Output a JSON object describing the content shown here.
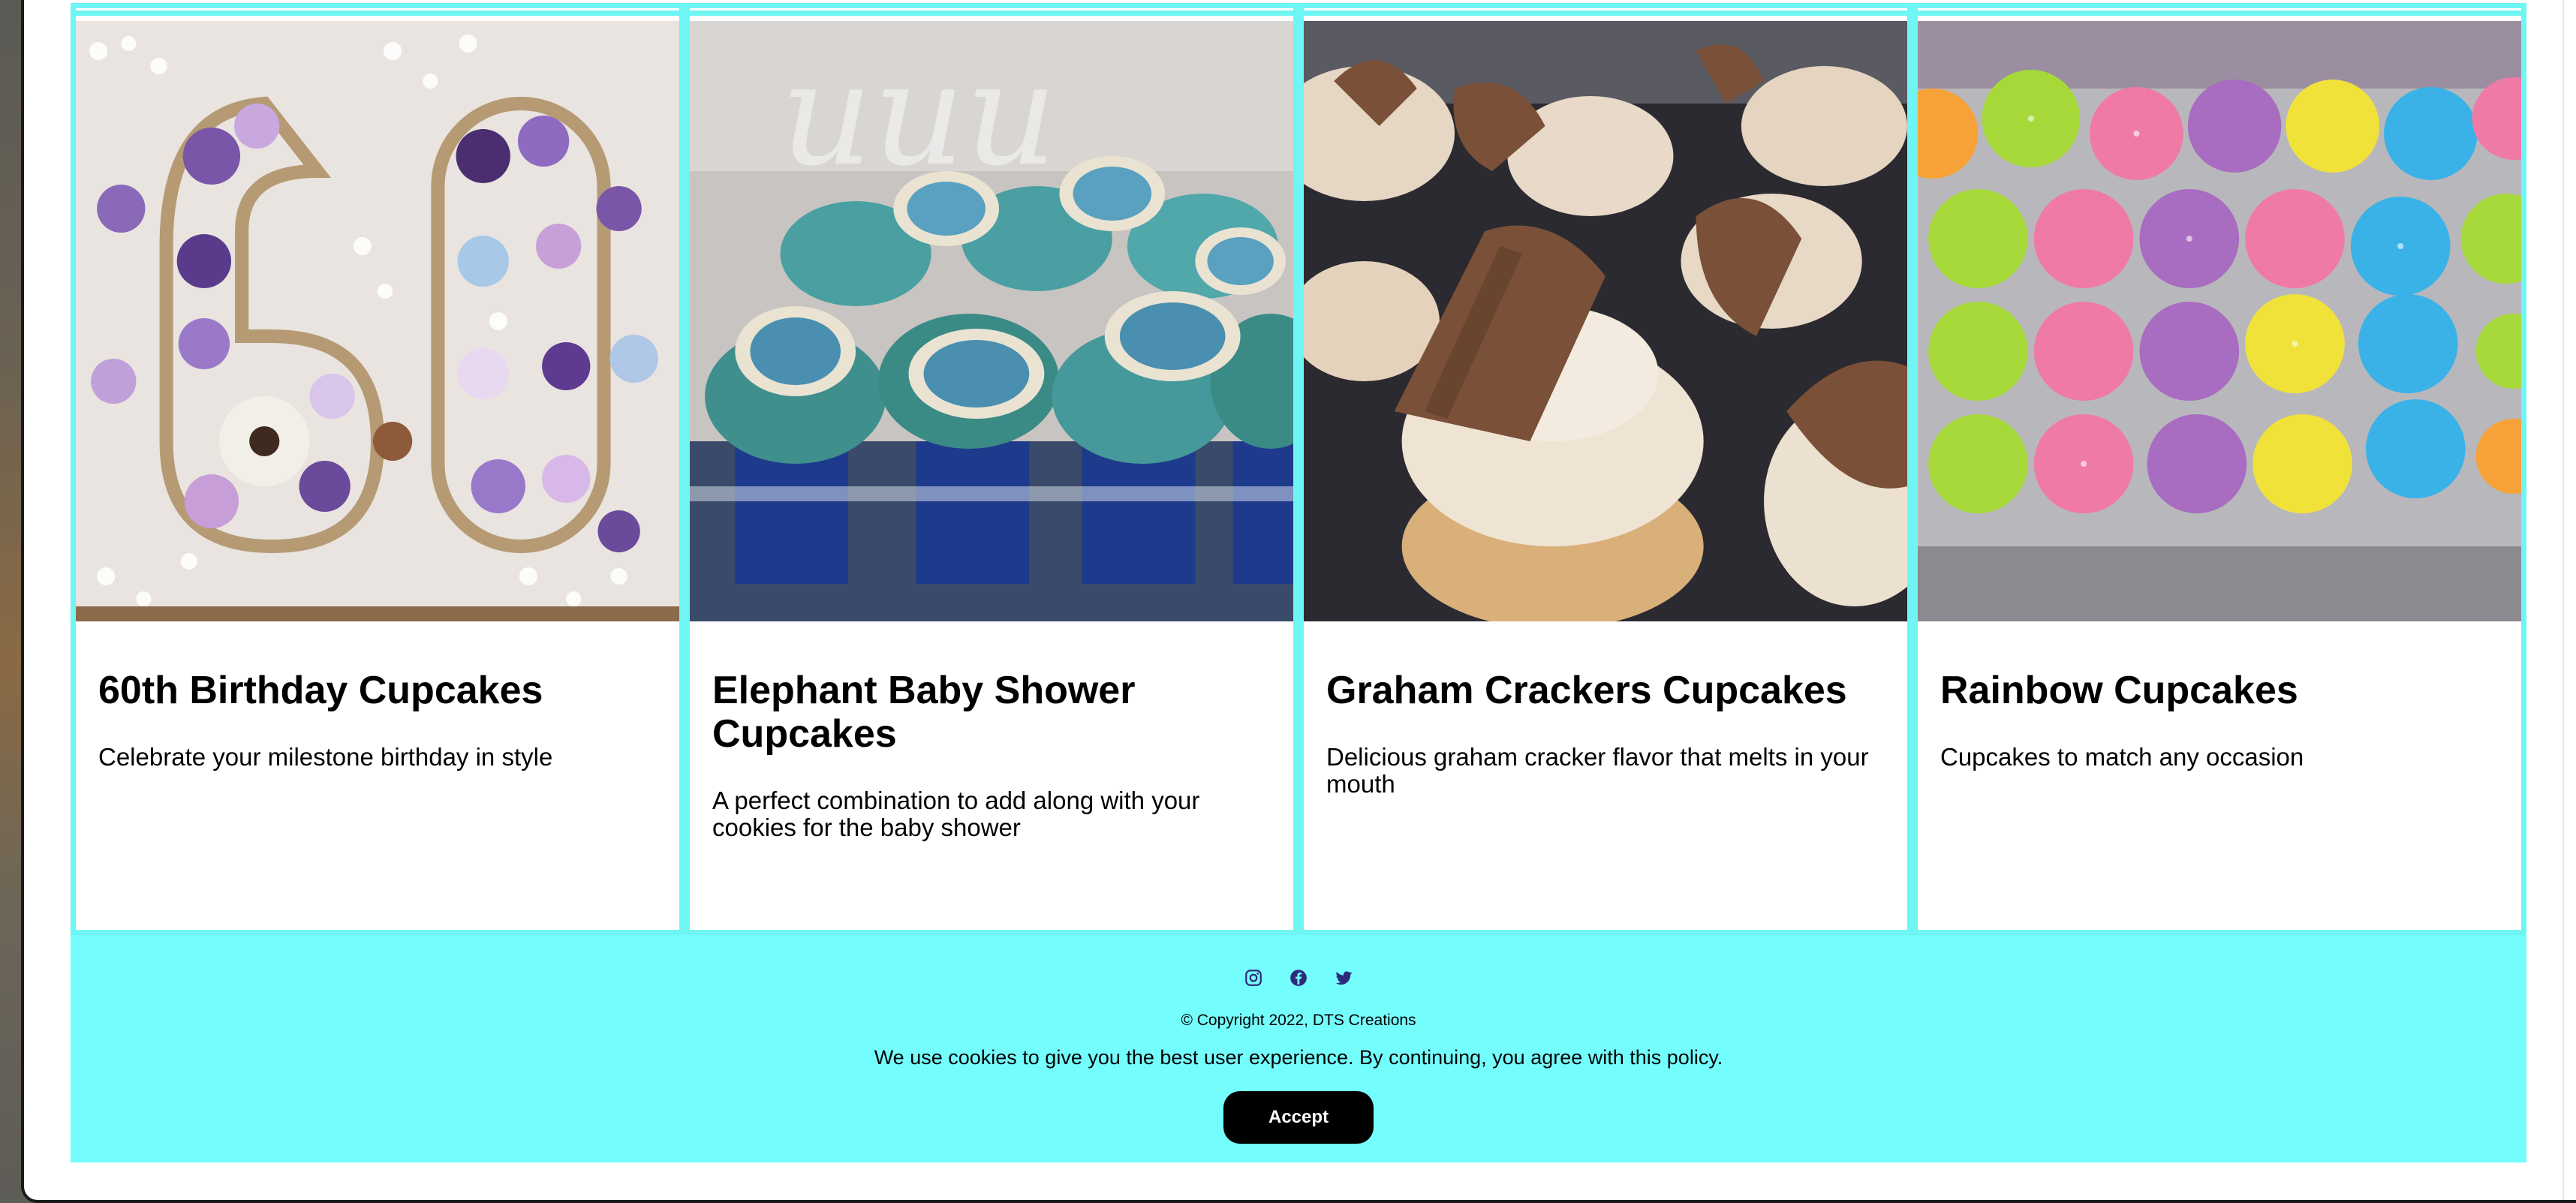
{
  "cards": [
    {
      "title": "60th Birthday Cupcakes",
      "description": "Celebrate your milestone birthday in style",
      "image": "cupcakes-60-photo"
    },
    {
      "title": "Elephant Baby Shower Cupcakes",
      "description": "A perfect combination to add along with your cookies for the baby shower",
      "image": "elephant-cupcakes-photo"
    },
    {
      "title": "Graham Crackers Cupcakes",
      "description": "Delicious graham cracker flavor that melts in your mouth",
      "image": "graham-cupcakes-photo"
    },
    {
      "title": "Rainbow Cupcakes",
      "description": "Cupcakes to match any occasion",
      "image": "rainbow-cupcakes-photo"
    }
  ],
  "footer": {
    "social_icons": [
      "instagram-icon",
      "facebook-icon",
      "twitter-icon"
    ],
    "copyright": "© Copyright 2022, DTS Creations",
    "cookie_notice": "We use cookies to give you the best user experience. By continuing, you agree with this policy.",
    "accept_label": "Accept"
  },
  "colors": {
    "accent": "#74fdfd",
    "card_border": "#6ff5f3",
    "button_bg": "#000000",
    "social_icon": "#2c2a7a"
  }
}
